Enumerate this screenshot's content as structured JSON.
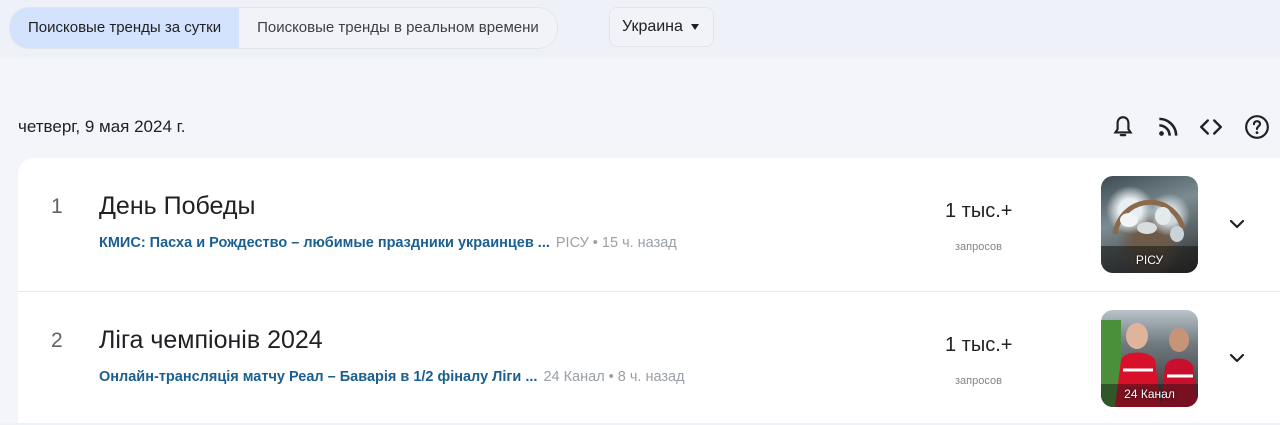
{
  "tabs": {
    "daily": "Поисковые тренды за сутки",
    "realtime": "Поисковые тренды в реальном времени"
  },
  "country": "Украина",
  "date": "четверг, 9 мая 2024 г.",
  "tools": {
    "icons": [
      "bell-icon",
      "rss-icon",
      "embed-code-icon",
      "help-icon"
    ]
  },
  "trends": [
    {
      "rank": "1",
      "title": "День Победы",
      "article": "КМИС: Пасха и Рождество – любимые праздники украинцев ...",
      "meta": "РІСУ • 15 ч. назад",
      "count": "1 тыс.+",
      "count_label": "запросов",
      "thumb_source": "РІСУ"
    },
    {
      "rank": "2",
      "title": "Ліга чемпіонів 2024",
      "article": "Онлайн-трансляція матчу Реал – Баварія в 1/2 фіналу Ліги ...",
      "meta": "24 Канал • 8 ч. назад",
      "count": "1 тыс.+",
      "count_label": "запросов",
      "thumb_source": "24 Канал"
    }
  ],
  "colors": {
    "active_tab": "#d3e3fd",
    "link": "#1a5f8f",
    "background": "#f3f5fa"
  }
}
